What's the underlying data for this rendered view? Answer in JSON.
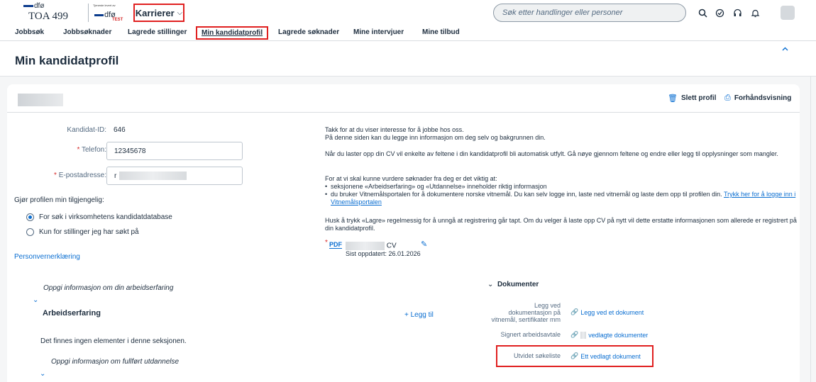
{
  "header": {
    "logo_top": "dfø",
    "logo_toa": "TOA 499",
    "logo_small": "Tjeneste levert av",
    "logo_dfo": "dfø",
    "logo_test": "TEST",
    "product": "Karrierer",
    "search_placeholder": "Søk etter handlinger eller personer"
  },
  "nav": {
    "items": [
      "Jobbsøk",
      "Jobbsøknader",
      "Lagrede stillinger",
      "Min kandidatprofil",
      "Lagrede søknader",
      "Mine intervjuer",
      "Mine tilbud"
    ],
    "active_index": 3
  },
  "page": {
    "title": "Min kandidatprofil",
    "delete_profile": "Slett profil",
    "preview": "Forhåndsvisning"
  },
  "profile": {
    "candidate_id_label": "Kandidat-ID:",
    "candidate_id": "646",
    "phone_label": "Telefon:",
    "phone": "12345678",
    "email_label": "E-postadresse:",
    "email_start": "r",
    "required_mark": "*",
    "availability_question": "Gjør profilen min tilgjengelig:",
    "option_database": "For søk i virksomhetens kandidatdatabase",
    "option_applied": "Kun for stillinger jeg har søkt på",
    "privacy_link": "Personvernerklæring"
  },
  "info": {
    "p1a": "Takk for at du viser interesse for å jobbe hos oss.",
    "p1b": "På denne siden kan du legge inn informasjon om deg selv og bakgrunnen din.",
    "p2": "Når du laster opp din CV vil enkelte av feltene i din kandidatprofil bli automatisk utfylt. Gå nøye gjennom feltene og endre eller legg til opplysninger som mangler.",
    "p3": "For at vi skal kunne vurdere søknader fra deg er det viktig at:",
    "bullet1": "seksjonene «Arbeidserfaring» og «Utdannelse» inneholder riktig informasjon",
    "bullet2": "du bruker Vitnemålsportalen for å dokumentere norske vitnemål. Du kan selv logge inn, laste ned vitnemål og laste dem opp til profilen din.",
    "bullet2_link": "Trykk her for å logge inn i Vitnemålsportalen",
    "p4": "Husk å trykk «Lagre» regelmessig for å unngå at registrering går tapt. Om du velger å laste opp CV på nytt vil dette erstatte informasjonen som allerede er registrert på din kandidatprofil.",
    "pdf_label": "PDF",
    "cv_suffix": "CV",
    "last_updated": "Sist oppdatert: 26.01.2026"
  },
  "work": {
    "prompt": "Oppgi informasjon om din arbeidserfaring",
    "title": "Arbeidserfaring",
    "add": "+ Legg til",
    "empty": "Det finnes ingen elementer i denne seksjonen.",
    "edu_prompt": "Oppgi informasjon om fullført utdannelse"
  },
  "documents": {
    "title": "Dokumenter",
    "rows": [
      {
        "label_lines": [
          "Legg ved",
          "dokumentasjon på",
          "vitnemål, sertifikater mm"
        ],
        "link": "Legg ved et dokument"
      },
      {
        "label_lines": [
          "Signert arbeidsavtale"
        ],
        "link": "vedlagte dokumenter"
      },
      {
        "label_lines": [
          "Utvidet søkeliste"
        ],
        "link": "Ett vedlagt dokument"
      }
    ]
  },
  "colors": {
    "accent": "#0a6ed1",
    "highlight": "#e02020",
    "text": "#1d2d3e"
  }
}
